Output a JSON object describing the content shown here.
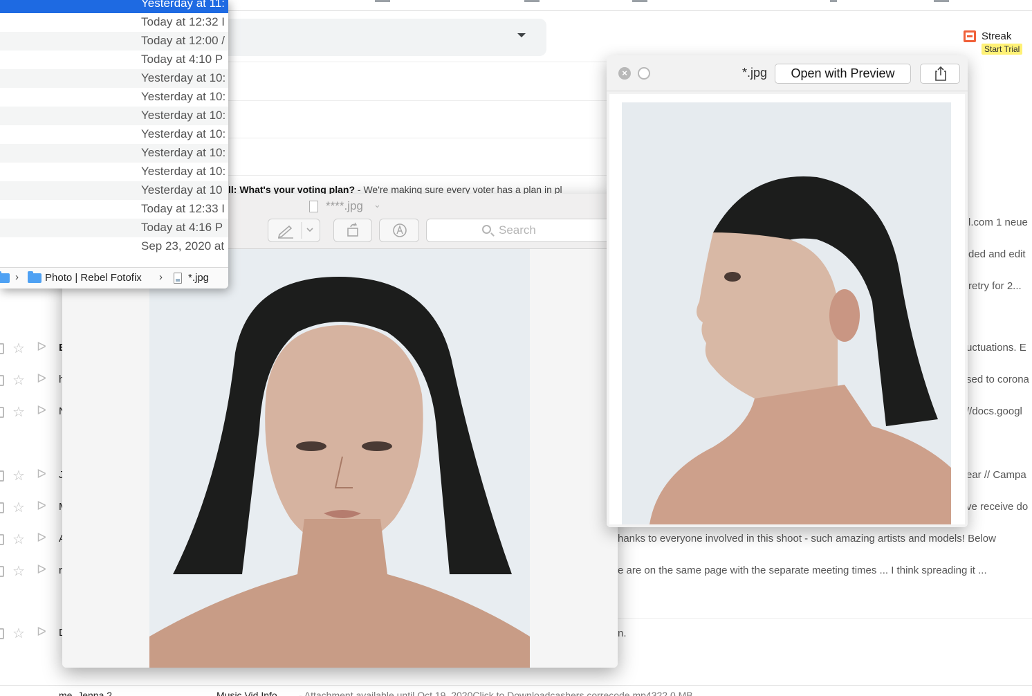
{
  "finder": {
    "dates": [
      "Yesterday at 11:",
      "Today at 12:32 I",
      "Today at 12:00 /",
      "Today at 4:10 P",
      "Yesterday at 10:",
      "Yesterday at 10:",
      "Yesterday at 10:",
      "Yesterday at 10:",
      "Yesterday at 10:",
      "Yesterday at 10:",
      "Yesterday at 10",
      "Today at 12:33 I",
      "Today at 4:16 P",
      "Sep 23, 2020 at"
    ],
    "path": {
      "folder": "Photo | Rebel Fotofix",
      "file": "*.jpg"
    }
  },
  "gmail": {
    "streak": {
      "name": "Streak",
      "trial": "Start Trial"
    },
    "subject_bold": "ll: What's your voting plan?",
    "subject_snippet": " - We're making sure every voter has a plan in pl",
    "rows": [
      {
        "sender": "E",
        "snippet": "uctuations. E"
      },
      {
        "sender": "h",
        "snippet": "sed to corona"
      },
      {
        "sender": "N",
        "snippet": "//docs.googl"
      },
      {
        "sender": "J",
        "snippet": "ear // Campa"
      },
      {
        "sender": "M",
        "snippet": "ve receive do"
      },
      {
        "sender": "A",
        "snippet": ""
      },
      {
        "sender": "r",
        "snippet": ""
      },
      {
        "sender": "D",
        "snippet": ""
      }
    ],
    "right_snippets": [
      "l.com 1 neue",
      "ded and edit",
      "retry for 2..."
    ],
    "long_lines": [
      "hanks to everyone involved in this shoot - such amazing artists and models! Below",
      "e are on the same page with the separate meeting times ... I think spreading it ...",
      "n."
    ],
    "bottom": {
      "sender": "me, Jenna 2",
      "subject": "Music Vid Info",
      "snippet": "- Attachment available until Oct 19, 2020Click to Downloadcashers correcode.mp4322.0 MB"
    }
  },
  "preview": {
    "filename": "****.jpg",
    "search_placeholder": "Search"
  },
  "quicklook": {
    "filename": "*.jpg",
    "open_label": "Open with Preview"
  }
}
